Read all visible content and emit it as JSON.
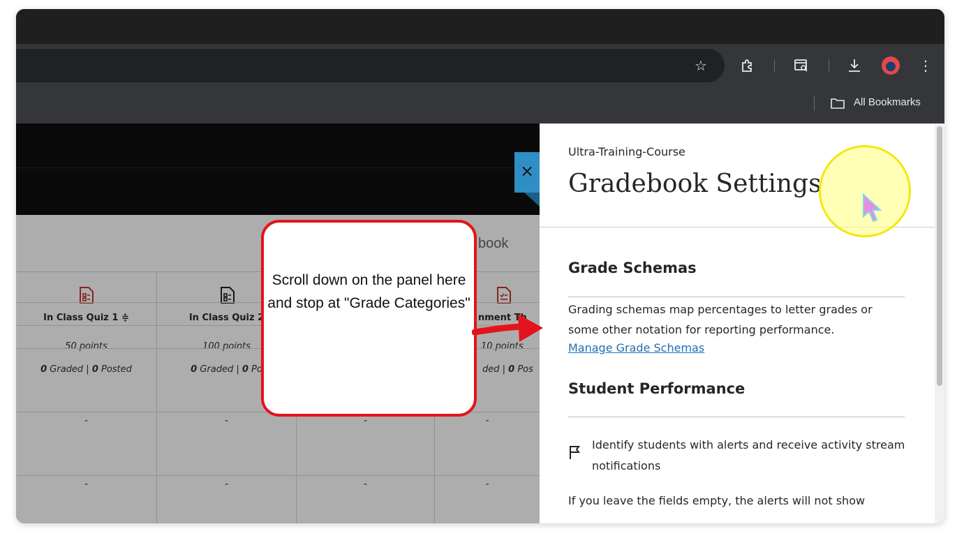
{
  "browser": {
    "bookmarks_bar": {
      "all_bookmarks_label": "All Bookmarks"
    },
    "toolbar_icons": [
      "star-icon",
      "extensions-icon",
      "tab-search-icon",
      "download-icon",
      "profile-avatar",
      "more-icon"
    ]
  },
  "gradebook": {
    "search_fragment": "book",
    "columns": [
      {
        "title": "In Class Quiz 1 ≑",
        "points": "50 points",
        "graded_count": "0",
        "graded_word": " Graded | ",
        "posted_count": "0",
        "posted_word": " Posted",
        "icon": "quiz-icon",
        "icon_color": "#c0392b"
      },
      {
        "title": "In Class Quiz 2",
        "points": "100 points",
        "graded_count": "0",
        "graded_word": " Graded | ",
        "posted_count": "0",
        "posted_word": " Po",
        "icon": "quiz-icon",
        "icon_color": "#222222"
      },
      {
        "title": "",
        "points": "",
        "graded_count": "",
        "graded_word": "",
        "posted_count": "",
        "posted_word": "",
        "icon": "",
        "icon_color": ""
      },
      {
        "title": "nment Th",
        "points": "10 points",
        "graded_count": "",
        "graded_word": "ded | ",
        "posted_count": "0",
        "posted_word": " Pos",
        "icon": "assignment-icon",
        "icon_color": "#c0392b"
      }
    ],
    "row_value": "-"
  },
  "panel": {
    "course_name": "Ultra-Training-Course",
    "title": "Gradebook Settings",
    "close_label": "×",
    "grade_schemas": {
      "heading": "Grade Schemas",
      "description": "Grading schemas map percentages to letter grades or some other notation for reporting performance.",
      "link": "Manage Grade Schemas"
    },
    "student_performance": {
      "heading": "Student Performance",
      "alert_text": "Identify students with alerts and receive activity stream notifications",
      "empty_fields_text": "If you leave the fields empty, the alerts will not show"
    }
  },
  "annotation": {
    "callout_text": "Scroll down on the panel here and stop at \"Grade Categories\"",
    "border_color": "#e3141b"
  }
}
